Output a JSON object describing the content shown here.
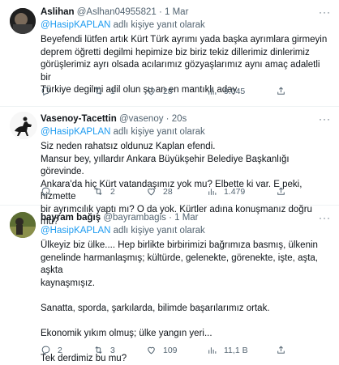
{
  "tweets": [
    {
      "name": "Aslihan",
      "handle": "@Aslhan04955821",
      "time": "1 Mar",
      "reply_prefix": "",
      "reply_mention": "@HasipKAPLAN",
      "reply_suffix": " adlı kişiye yanıt olarak",
      "text": "Beyefendi lütfen artık Kürt Türk ayrımı yada başka ayrımlara girmeyin\ndeprem öğretti degilmi hepimize biz biriz tekiz dillerimiz dinlerimiz\ngörüşlerimiz ayrı olsada acılarımız gözyaşlarımız aynı amaç adaletli bir\nTürkiye degilmi adil olun şu an en mantıklı aday",
      "replies": "",
      "retweets": "1",
      "likes": "28",
      "views": "9.045"
    },
    {
      "name": "Vasenoy-Tacettin",
      "handle": "@vasenoy",
      "time": "20s",
      "reply_prefix": "",
      "reply_mention": "@HasipKAPLAN",
      "reply_suffix": " adlı kişiye yanıt olarak",
      "text": "Siz neden rahatsız oldunuz Kaplan efendi.\nMansur bey, yıllardır Ankara Büyükşehir Belediye Başkanlığı görevinde.\nAnkara'da hiç Kürt vatandaşımız yok mu? Elbette ki var. E peki, hizmette\nbir ayrımcılık yaptı mı? O da yok. Kürtler adına konuşmanız doğru mu?",
      "replies": "",
      "retweets": "2",
      "likes": "28",
      "views": "1.479"
    },
    {
      "name": "bayram bağış",
      "handle": "@bayrambagis",
      "time": "1 Mar",
      "reply_prefix": "",
      "reply_mention": "@HasipKAPLAN",
      "reply_suffix": " adlı kişiye yanıt olarak",
      "text": "Ülkeyiz biz ülke.... Hep birlikte birbirimizi bağrımıza basmış, ülkenin\ngenelinde harmanlaşmış; kültürde, gelenekte, görenekte, işte, aşta, aşkta\nkaynaşmışız.\n\nSanatta, sporda, şarkılarda, bilimde başarılarımız ortak.\n\nEkonomik yıkım olmuş; ülke yangın yeri...\n\nTek derdimiz bu mu?",
      "replies": "2",
      "retweets": "3",
      "likes": "109",
      "views": "11,1 B"
    }
  ],
  "colors": {
    "text": "#0f1419",
    "secondary": "#536471",
    "link": "#1d9bf0",
    "border": "#eff3f4"
  },
  "icons": [
    "reply-icon",
    "retweet-icon",
    "like-icon",
    "views-icon",
    "share-icon",
    "more-icon"
  ]
}
